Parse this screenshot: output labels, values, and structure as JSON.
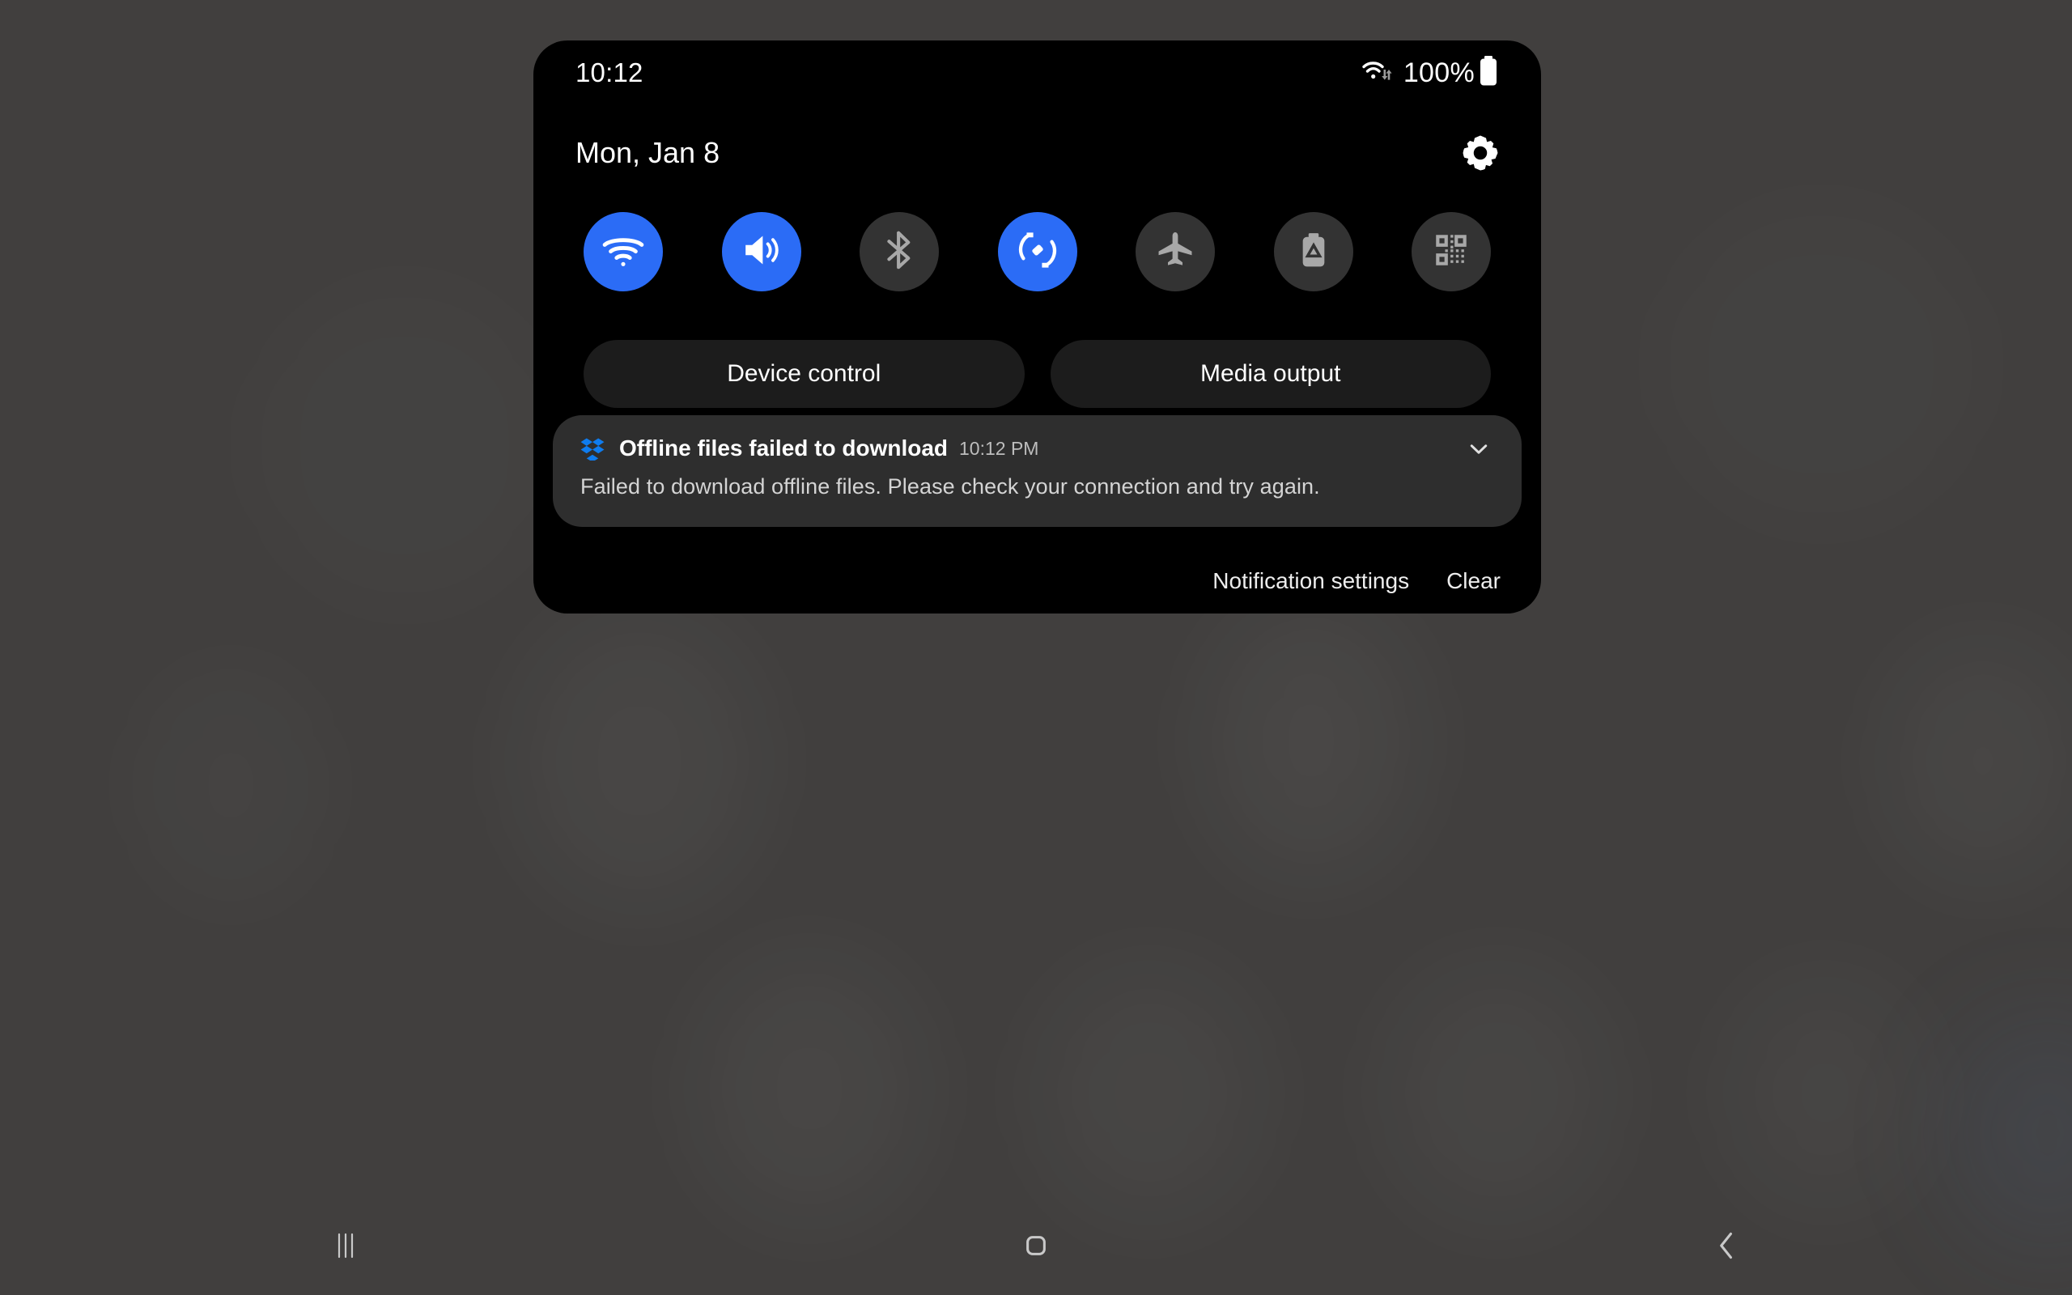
{
  "screen": {
    "background_color": "#413F3E",
    "panel_background": "#000000",
    "accent_color": "#2B6CF6",
    "inactive_toggle_color": "#333333",
    "card_color": "#2E2E2E",
    "dropbox_blue": "#0F7CEE"
  },
  "status_bar": {
    "clock": "10:12",
    "battery_percent": "100%",
    "wifi_icon": "wifi-data-arrows-icon",
    "battery_icon": "battery-full-icon"
  },
  "header": {
    "date": "Mon, Jan 8",
    "settings_icon": "gear-icon"
  },
  "quick_toggles": [
    {
      "name": "wifi",
      "icon": "wifi-icon",
      "label": "Wi-Fi",
      "state": "on"
    },
    {
      "name": "sound",
      "icon": "speaker-icon",
      "label": "Sound",
      "state": "on"
    },
    {
      "name": "bluetooth",
      "icon": "bluetooth-icon",
      "label": "Bluetooth",
      "state": "off"
    },
    {
      "name": "auto-rotate",
      "icon": "auto-rotate-icon",
      "label": "Auto rotate",
      "state": "on"
    },
    {
      "name": "airplane",
      "icon": "airplane-icon",
      "label": "Airplane mode",
      "state": "off"
    },
    {
      "name": "power-saving",
      "icon": "battery-saver-icon",
      "label": "Power saving",
      "state": "off"
    },
    {
      "name": "qr-scanner",
      "icon": "qr-code-icon",
      "label": "Scan QR code",
      "state": "off"
    }
  ],
  "panel_buttons": [
    {
      "name": "device-control",
      "label": "Device control"
    },
    {
      "name": "media-output",
      "label": "Media output"
    }
  ],
  "notification": {
    "app_icon": "dropbox-icon",
    "title": "Offline files failed to download",
    "time": "10:12 PM",
    "body": "Failed to download offline files. Please check your connection and try again.",
    "expand_icon": "chevron-down-icon"
  },
  "notification_actions": {
    "settings_label": "Notification settings",
    "clear_label": "Clear"
  },
  "nav_bar": {
    "recents_icon": "recents-lines-icon",
    "home_icon": "home-square-icon",
    "back_icon": "chevron-left-icon"
  }
}
